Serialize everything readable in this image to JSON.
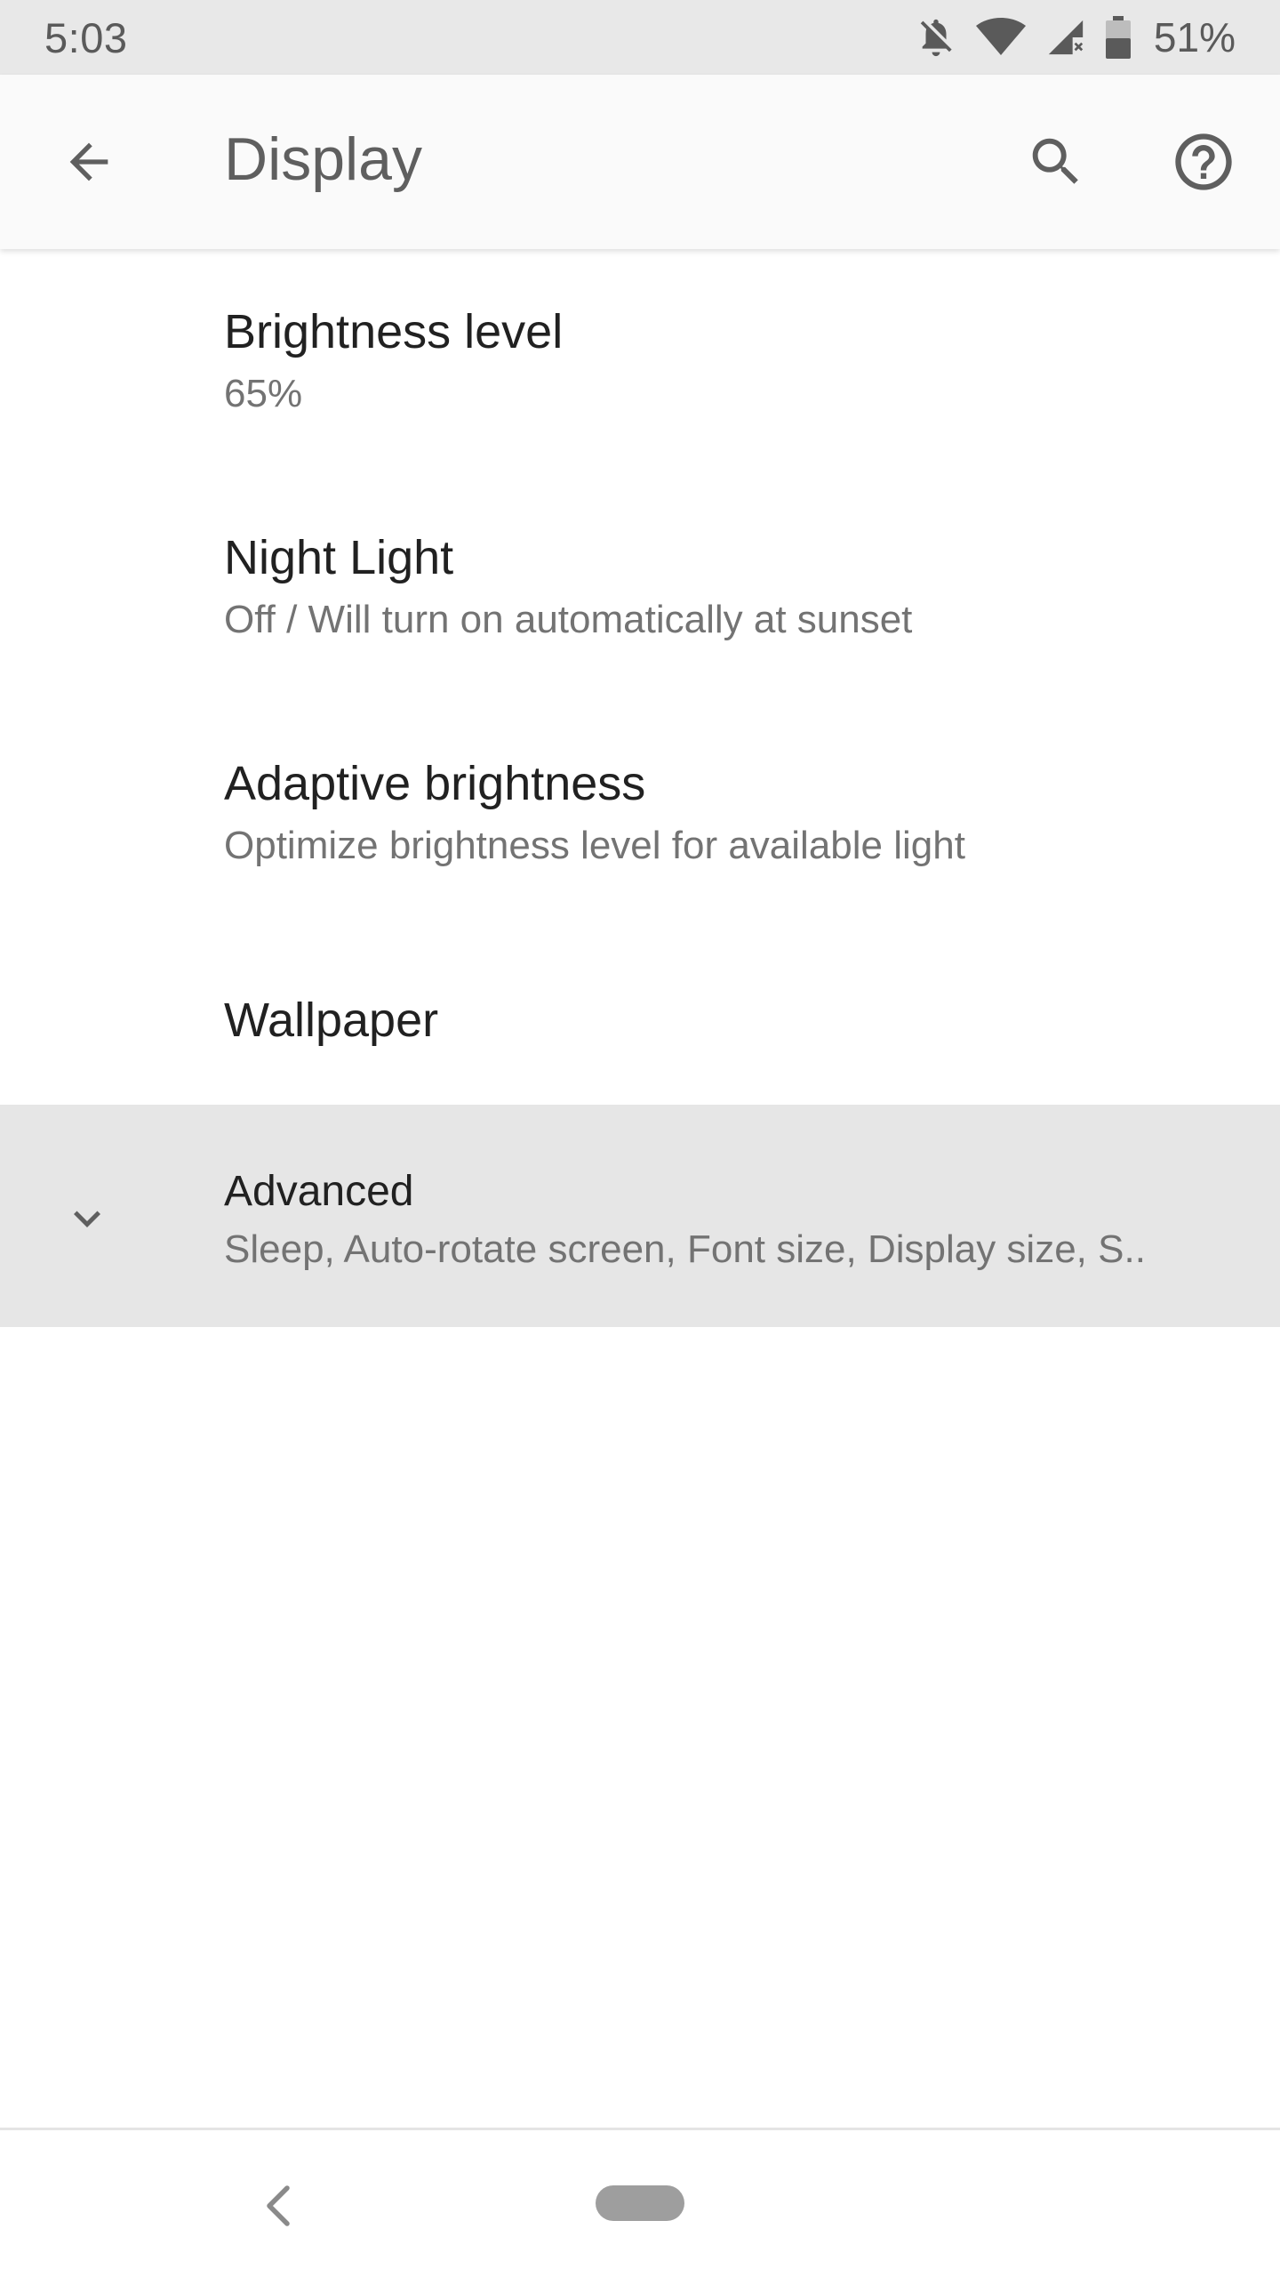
{
  "status_bar": {
    "time": "5:03",
    "battery_percent": "51%",
    "icons": [
      "notifications-off-icon",
      "wifi-icon",
      "cellular-no-data-icon",
      "battery-icon"
    ]
  },
  "app_bar": {
    "title": "Display",
    "back_icon": "arrow-left-icon",
    "search_icon": "search-icon",
    "help_icon": "help-circle-icon"
  },
  "settings": {
    "brightness": {
      "title": "Brightness level",
      "summary": "65%"
    },
    "night_light": {
      "title": "Night Light",
      "summary": "Off / Will turn on automatically at sunset"
    },
    "adaptive_brightness": {
      "title": "Adaptive brightness",
      "summary": "Optimize brightness level for available light"
    },
    "wallpaper": {
      "title": "Wallpaper"
    },
    "advanced": {
      "title": "Advanced",
      "summary": "Sleep, Auto-rotate screen, Font size, Display size, S..",
      "icon": "chevron-down-icon"
    }
  },
  "nav_bar": {
    "back_icon": "nav-back-icon",
    "home_icon": "home-pill-icon"
  },
  "colors": {
    "status_bar_bg": "#e8e8e8",
    "app_bar_bg": "#fafafa",
    "highlight_bg": "#e6e6e6",
    "title_text": "#212121",
    "summary_text": "#737373"
  }
}
